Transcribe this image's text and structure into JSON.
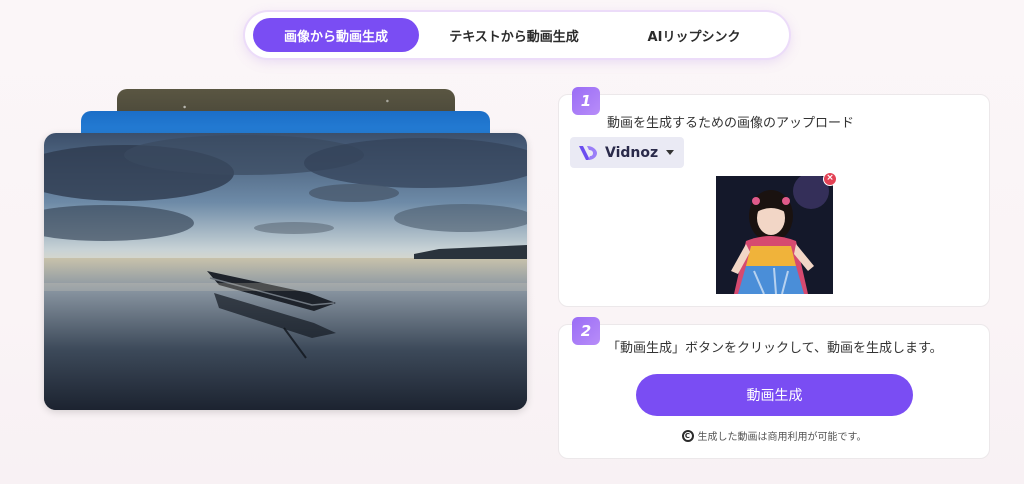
{
  "tabs": [
    {
      "label": "画像から動画生成",
      "active": true
    },
    {
      "label": "テキストから動画生成",
      "active": false
    },
    {
      "label": "AIリップシンク",
      "active": false
    }
  ],
  "step1": {
    "number": "1",
    "text": "動画を生成するための画像のアップロード",
    "brand": "Vidnoz",
    "remove_icon": "close-icon"
  },
  "step2": {
    "number": "2",
    "text": "「動画生成」ボタンをクリックして、動画を生成します。",
    "button": "動画生成",
    "note": "生成した動画は商用利用が可能です。",
    "note_icon": "copyright-icon"
  },
  "colors": {
    "accent": "#7a4df3",
    "badge": "#9a6cf6",
    "remove": "#e34255"
  }
}
